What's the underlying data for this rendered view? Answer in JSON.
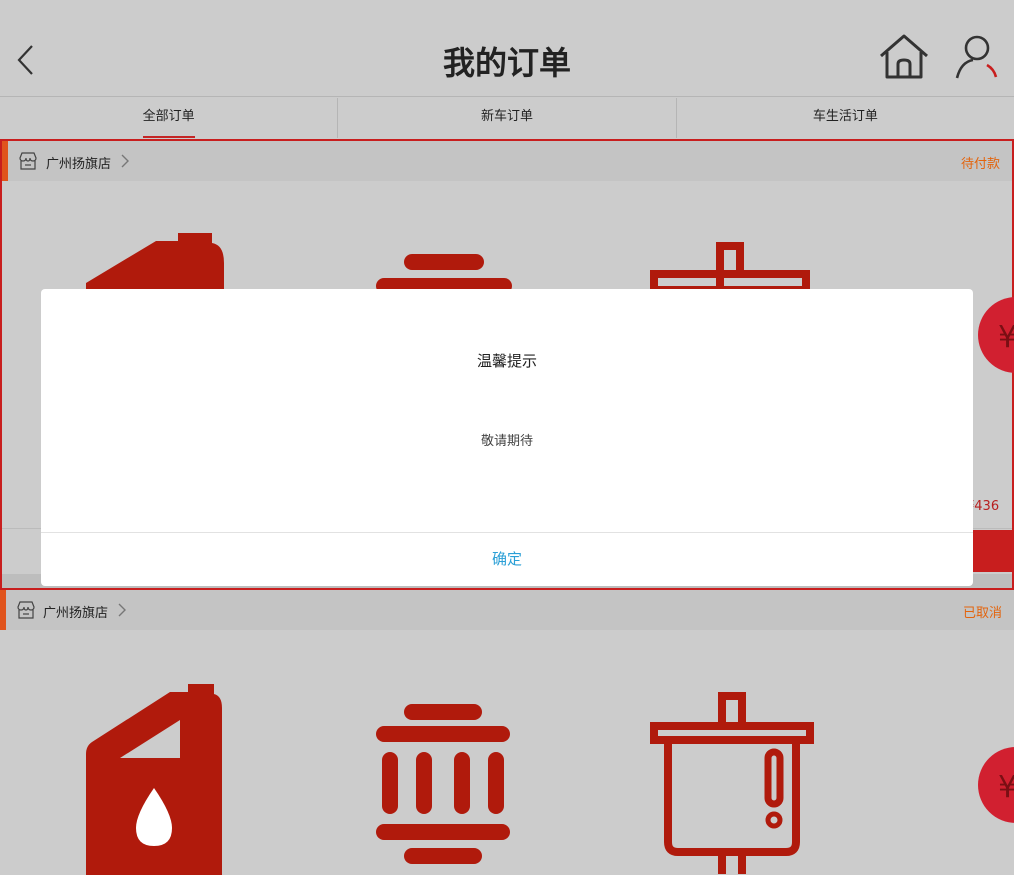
{
  "header": {
    "title": "我的订单",
    "back_icon": "chevron-left-icon",
    "home_icon": "home-icon",
    "user_icon": "user-icon"
  },
  "tabs": [
    {
      "label": "全部订单",
      "active": true
    },
    {
      "label": "新车订单",
      "active": false
    },
    {
      "label": "车生活订单",
      "active": false
    }
  ],
  "orders": [
    {
      "shop_name": "广州扬旗店",
      "status": "待付款",
      "price_fragment": "436",
      "products": [
        "oil-can-icon",
        "air-filter-icon",
        "fuel-filter-icon"
      ]
    },
    {
      "shop_name": "广州扬旗店",
      "status": "已取消",
      "products": [
        "oil-can-icon",
        "air-filter-icon",
        "fuel-filter-icon"
      ]
    }
  ],
  "dialog": {
    "title": "温馨提示",
    "message": "敬请期待",
    "confirm_label": "确定"
  },
  "colors": {
    "accent_red": "#c81e1e",
    "status_orange": "#e3640d",
    "confirm_blue": "#2a9fd6",
    "icon_red": "#b01a0c"
  }
}
